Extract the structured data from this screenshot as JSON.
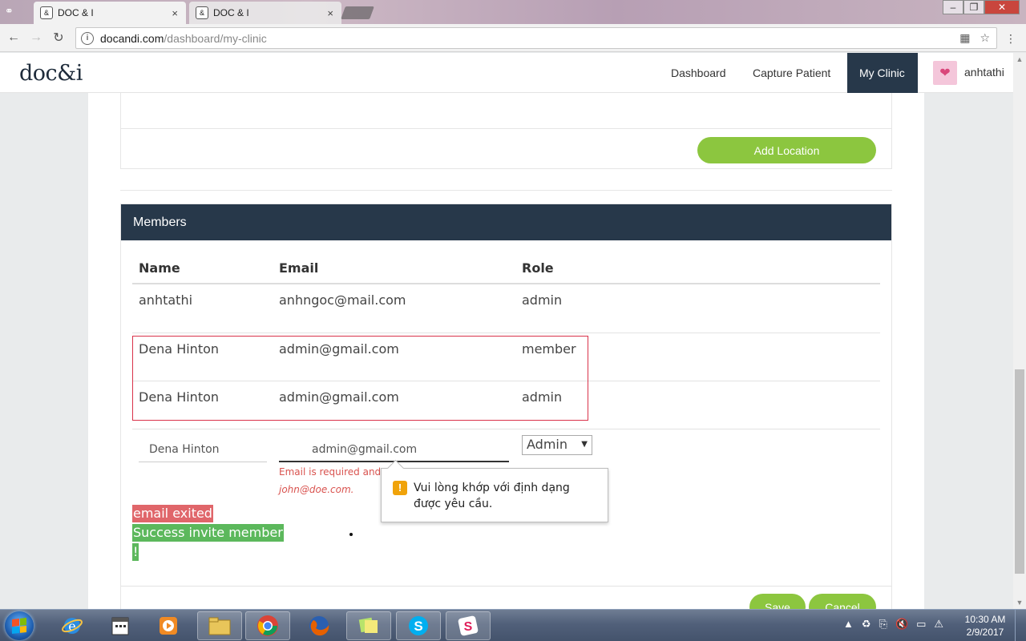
{
  "browser": {
    "tabs": [
      {
        "title": "DOC & I",
        "close": "×"
      },
      {
        "title": "DOC & I",
        "close": "×"
      }
    ],
    "url_host": "docandi.com",
    "url_path": "/dashboard/my-clinic",
    "window_controls": {
      "min": "–",
      "max": "❐",
      "close": "✕"
    }
  },
  "app": {
    "logo": "doc&i",
    "nav": [
      {
        "label": "Dashboard"
      },
      {
        "label": "Capture Patient"
      },
      {
        "label": "My Clinic"
      }
    ],
    "username": "anhtathi"
  },
  "locations": {
    "add_button": "Add Location"
  },
  "members": {
    "title": "Members",
    "columns": {
      "name": "Name",
      "email": "Email",
      "role": "Role"
    },
    "rows": [
      {
        "name": "anhtathi",
        "email": "anhngoc@mail.com",
        "role": "admin"
      },
      {
        "name": "Dena Hinton",
        "email": "admin@gmail.com",
        "role": "member"
      },
      {
        "name": "Dena Hinton",
        "email": "admin@gmail.com",
        "role": "admin"
      }
    ],
    "form": {
      "name_value": "Dena Hinton",
      "email_value": "admin@gmail.com",
      "role_selected": "Admin",
      "error_line1": "Email is required and",
      "error_line2": "john@doe.com."
    },
    "validation_tooltip": "Vui lòng khớp với định dạng được yêu cầu.",
    "alerts": {
      "error": "email exited",
      "success_line1": "Success invite member",
      "success_line2": "!"
    },
    "actions": {
      "save": "Save",
      "cancel": "Cancel"
    }
  },
  "taskbar": {
    "time": "10:30 AM",
    "date": "2/9/2017"
  },
  "colors": {
    "navy": "#27384a",
    "green": "#8cc63f",
    "error_red": "#d9534f",
    "success_green": "#5cb85c"
  }
}
